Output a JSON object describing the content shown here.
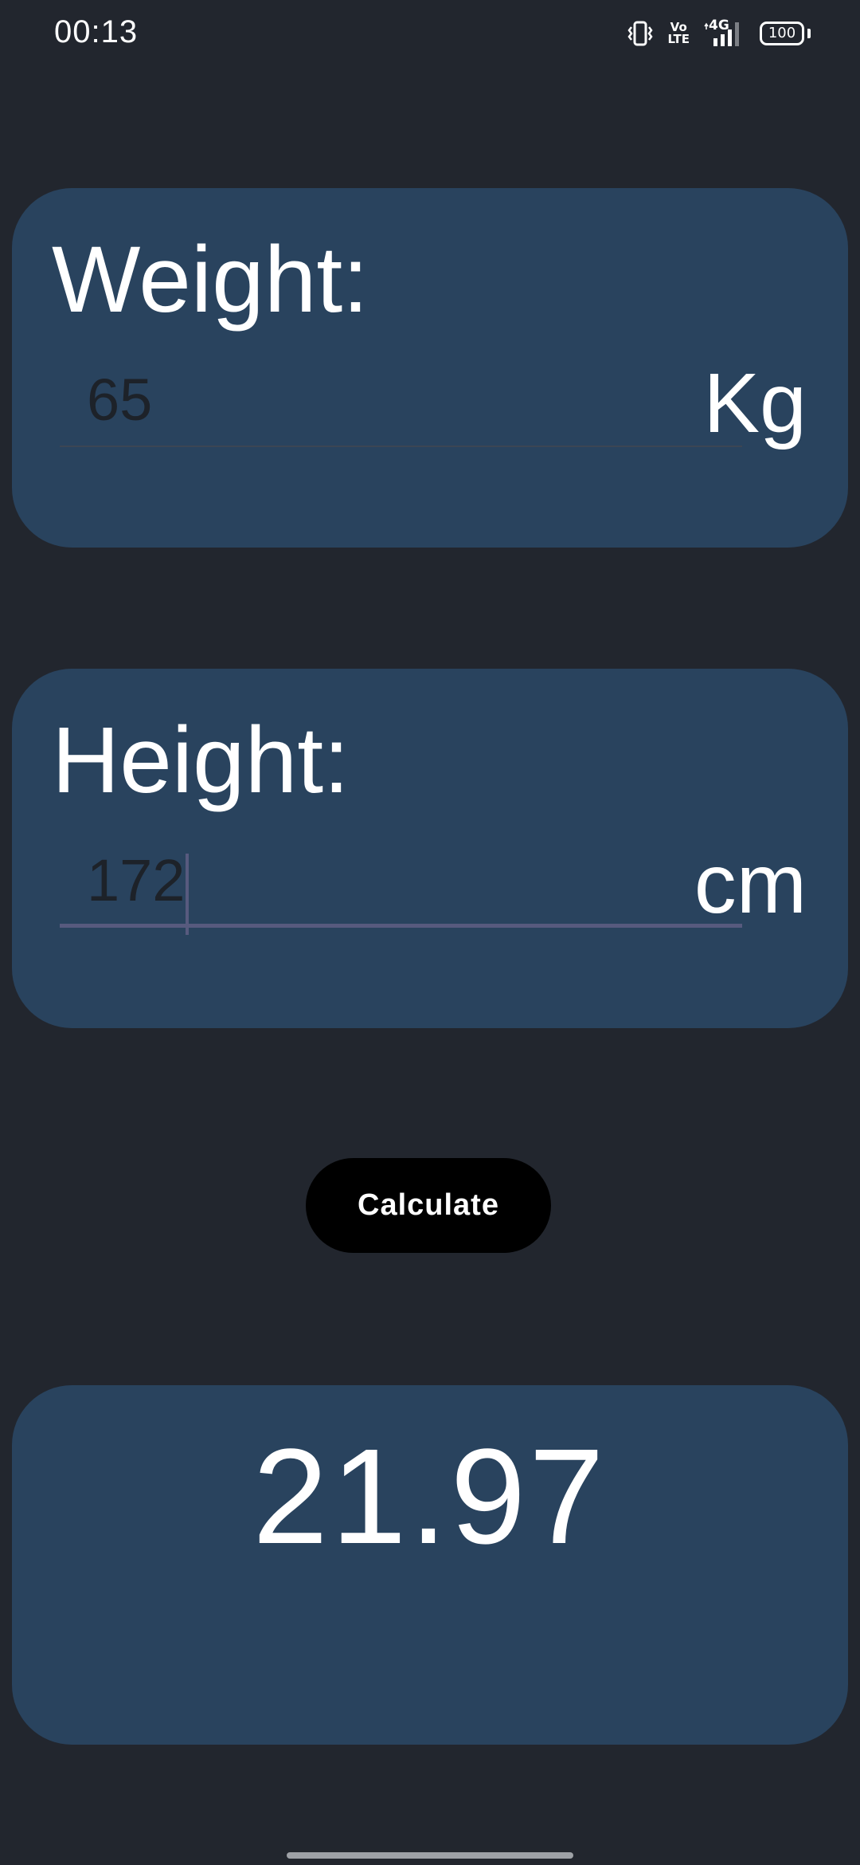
{
  "status_bar": {
    "time": "00:13",
    "volte_label_top": "Vo",
    "volte_label_bottom": "LTE",
    "network_label": "4G",
    "battery_level": "100",
    "icons": [
      "vibrate-icon",
      "volte-icon",
      "signal-icon",
      "battery-icon"
    ]
  },
  "weight": {
    "label": "Weight:",
    "value": "65",
    "unit": "Kg"
  },
  "height": {
    "label": "Height:",
    "value": "172",
    "unit": "cm"
  },
  "actions": {
    "calculate_label": "Calculate"
  },
  "result": {
    "value": "21.97"
  },
  "colors": {
    "background": "#22262e",
    "card": "#29435e",
    "input_text": "#1d2229",
    "focus_accent": "#575a7e",
    "button": "#000000",
    "text": "#ffffff"
  }
}
